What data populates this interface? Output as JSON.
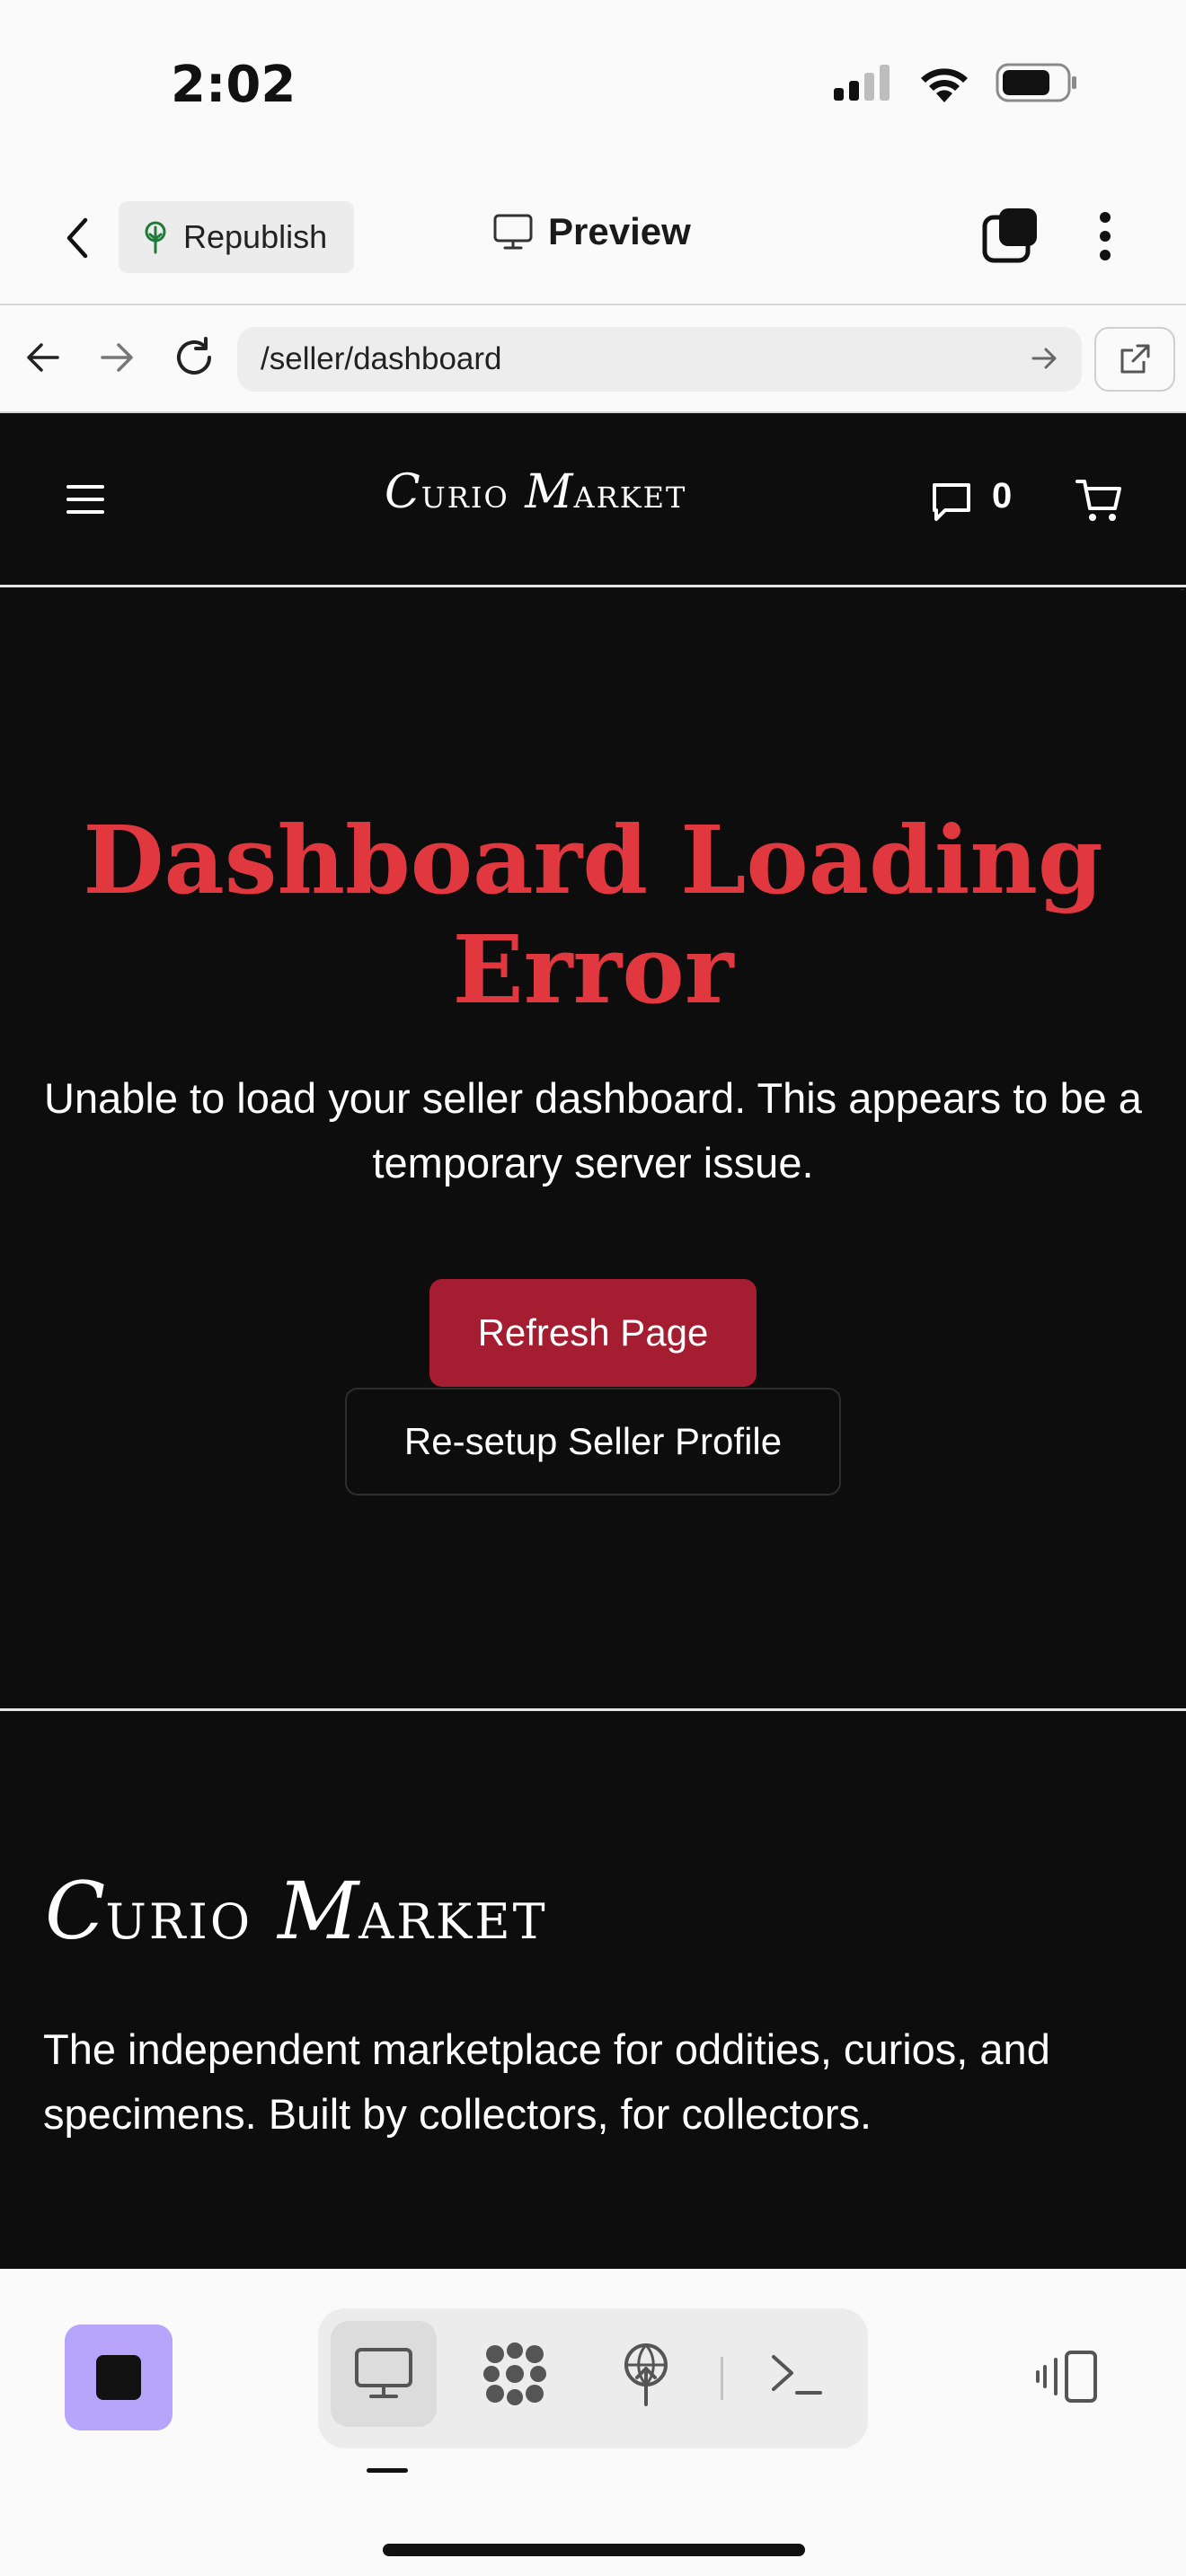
{
  "status_bar": {
    "time": "2:02"
  },
  "top_bar": {
    "republish_label": "Republish",
    "preview_label": "Preview"
  },
  "url_bar": {
    "url": "/seller/dashboard"
  },
  "site_header": {
    "logo_initial_1": "C",
    "logo_rest_1": "urio",
    "logo_initial_2": "M",
    "logo_rest_2": "arket",
    "message_count": "0"
  },
  "error": {
    "title": "Dashboard Loading Error",
    "description": "Unable to load your seller dashboard. This appears to be a temporary server issue.",
    "refresh_label": "Refresh Page",
    "resetup_label": "Re-setup Seller Profile"
  },
  "footer": {
    "logo_initial_1": "C",
    "logo_rest_1": "urio",
    "logo_initial_2": "M",
    "logo_rest_2": "arket",
    "tagline": "The independent marketplace for oddities, curios, and specimens. Built by collectors, for collectors."
  },
  "colors": {
    "error_title": "#e0383e",
    "primary_button": "#a41d30",
    "page_background": "#0d0d0d",
    "stop_button": "#b7a4fb"
  },
  "icons": [
    "signal-icon",
    "wifi-icon",
    "battery-icon",
    "back-chevron-icon",
    "tree-icon",
    "monitor-icon",
    "tabs-icon",
    "more-icon",
    "arrow-left-icon",
    "arrow-right-icon",
    "reload-icon",
    "go-icon",
    "external-link-icon",
    "hamburger-icon",
    "message-icon",
    "cart-icon",
    "stop-icon",
    "desktop-icon",
    "apps-icon",
    "publish-icon",
    "terminal-icon",
    "layout-icon"
  ]
}
